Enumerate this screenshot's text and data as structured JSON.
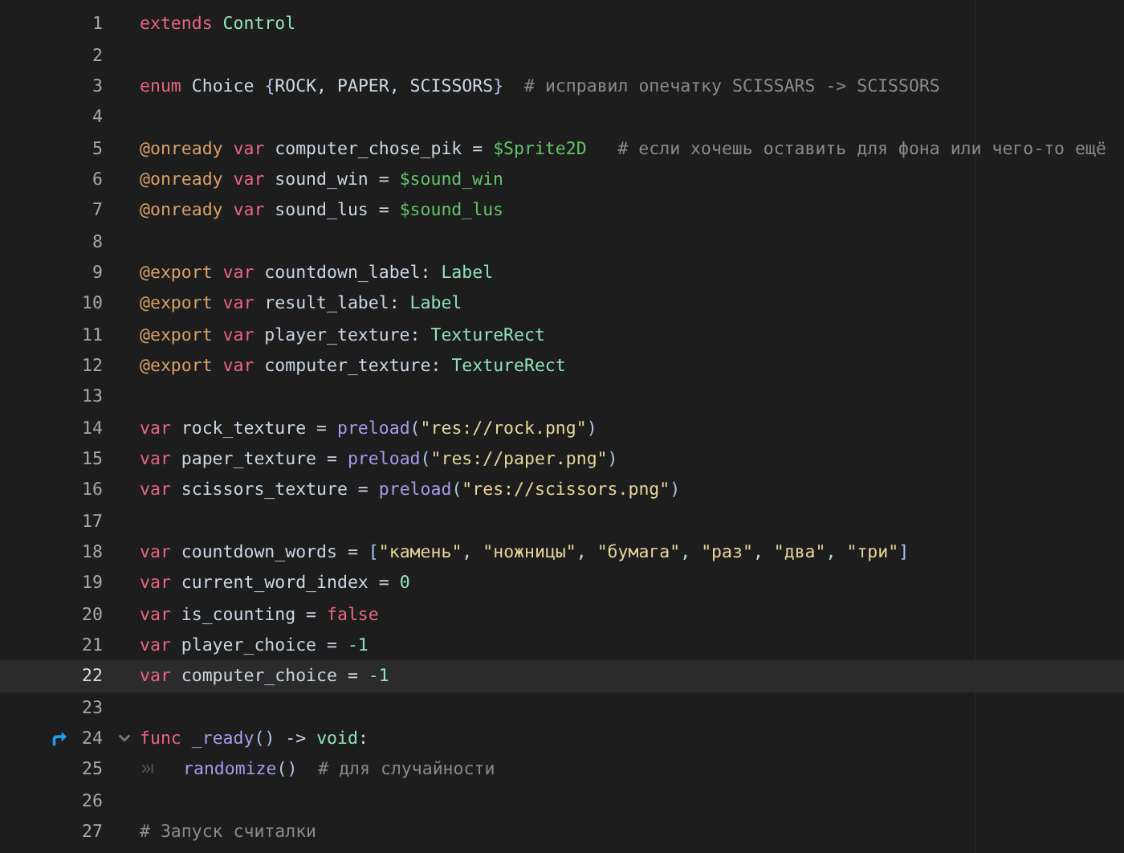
{
  "editor": {
    "lines": [
      {
        "number": "1",
        "current": false,
        "tokens": [
          {
            "kind": "keyword",
            "text": "extends "
          },
          {
            "kind": "type",
            "text": "Control"
          }
        ]
      },
      {
        "number": "2",
        "current": false
      },
      {
        "number": "3",
        "current": false,
        "tokens": [
          {
            "kind": "keyword",
            "text": "enum "
          },
          {
            "kind": "plain",
            "text": "Choice "
          },
          {
            "kind": "bracket",
            "text": "{"
          },
          {
            "kind": "plain",
            "text": "ROCK, PAPER, SCISSORS"
          },
          {
            "kind": "bracket",
            "text": "}  "
          },
          {
            "kind": "comment",
            "text": "# исправил опечатку SCISSARS -> SCISSORS"
          }
        ]
      },
      {
        "number": "4",
        "current": false
      },
      {
        "number": "5",
        "current": false,
        "tokens": [
          {
            "kind": "annotation",
            "text": "@onready "
          },
          {
            "kind": "keyword",
            "text": "var"
          },
          {
            "kind": "plain",
            "text": " computer_chose_pik = "
          },
          {
            "kind": "nodepath",
            "text": "$Sprite2D   "
          },
          {
            "kind": "comment",
            "text": "# если хочешь оставить для фона или чего-то ещё"
          }
        ]
      },
      {
        "number": "6",
        "current": false,
        "tokens": [
          {
            "kind": "annotation",
            "text": "@onready "
          },
          {
            "kind": "keyword",
            "text": "var"
          },
          {
            "kind": "plain",
            "text": " sound_win = "
          },
          {
            "kind": "nodepath",
            "text": "$sound_win"
          }
        ]
      },
      {
        "number": "7",
        "current": false,
        "tokens": [
          {
            "kind": "annotation",
            "text": "@onready "
          },
          {
            "kind": "keyword",
            "text": "var"
          },
          {
            "kind": "plain",
            "text": " sound_lus = "
          },
          {
            "kind": "nodepath",
            "text": "$sound_lus"
          }
        ]
      },
      {
        "number": "8",
        "current": false
      },
      {
        "number": "9",
        "current": false,
        "tokens": [
          {
            "kind": "annotation",
            "text": "@export "
          },
          {
            "kind": "keyword",
            "text": "var"
          },
          {
            "kind": "plain",
            "text": " countdown_label: "
          },
          {
            "kind": "type",
            "text": "Label"
          }
        ]
      },
      {
        "number": "10",
        "current": false,
        "tokens": [
          {
            "kind": "annotation",
            "text": "@export "
          },
          {
            "kind": "keyword",
            "text": "var"
          },
          {
            "kind": "plain",
            "text": " result_label: "
          },
          {
            "kind": "type",
            "text": "Label"
          }
        ]
      },
      {
        "number": "11",
        "current": false,
        "tokens": [
          {
            "kind": "annotation",
            "text": "@export "
          },
          {
            "kind": "keyword",
            "text": "var"
          },
          {
            "kind": "plain",
            "text": " player_texture: "
          },
          {
            "kind": "type",
            "text": "TextureRect"
          }
        ]
      },
      {
        "number": "12",
        "current": false,
        "tokens": [
          {
            "kind": "annotation",
            "text": "@export "
          },
          {
            "kind": "keyword",
            "text": "var"
          },
          {
            "kind": "plain",
            "text": " computer_texture: "
          },
          {
            "kind": "type",
            "text": "TextureRect"
          }
        ]
      },
      {
        "number": "13",
        "current": false
      },
      {
        "number": "14",
        "current": false,
        "tokens": [
          {
            "kind": "keyword",
            "text": "var"
          },
          {
            "kind": "plain",
            "text": " rock_texture = "
          },
          {
            "kind": "function",
            "text": "preload"
          },
          {
            "kind": "bracket",
            "text": "("
          },
          {
            "kind": "string",
            "text": "\"res://rock.png\""
          },
          {
            "kind": "bracket",
            "text": ")"
          }
        ]
      },
      {
        "number": "15",
        "current": false,
        "tokens": [
          {
            "kind": "keyword",
            "text": "var"
          },
          {
            "kind": "plain",
            "text": " paper_texture = "
          },
          {
            "kind": "function",
            "text": "preload"
          },
          {
            "kind": "bracket",
            "text": "("
          },
          {
            "kind": "string",
            "text": "\"res://paper.png\""
          },
          {
            "kind": "bracket",
            "text": ")"
          }
        ]
      },
      {
        "number": "16",
        "current": false,
        "tokens": [
          {
            "kind": "keyword",
            "text": "var"
          },
          {
            "kind": "plain",
            "text": " scissors_texture = "
          },
          {
            "kind": "function",
            "text": "preload"
          },
          {
            "kind": "bracket",
            "text": "("
          },
          {
            "kind": "string",
            "text": "\"res://scissors.png\""
          },
          {
            "kind": "bracket",
            "text": ")"
          }
        ]
      },
      {
        "number": "17",
        "current": false
      },
      {
        "number": "18",
        "current": false,
        "tokens": [
          {
            "kind": "keyword",
            "text": "var"
          },
          {
            "kind": "plain",
            "text": " countdown_words = "
          },
          {
            "kind": "bracket",
            "text": "["
          },
          {
            "kind": "string",
            "text": "\"камень\""
          },
          {
            "kind": "plain",
            "text": ", "
          },
          {
            "kind": "string",
            "text": "\"ножницы\""
          },
          {
            "kind": "plain",
            "text": ", "
          },
          {
            "kind": "string",
            "text": "\"бумага\""
          },
          {
            "kind": "plain",
            "text": ", "
          },
          {
            "kind": "string",
            "text": "\"раз\""
          },
          {
            "kind": "plain",
            "text": ", "
          },
          {
            "kind": "string",
            "text": "\"два\""
          },
          {
            "kind": "plain",
            "text": ", "
          },
          {
            "kind": "string",
            "text": "\"три\""
          },
          {
            "kind": "bracket",
            "text": "]"
          }
        ]
      },
      {
        "number": "19",
        "current": false,
        "tokens": [
          {
            "kind": "keyword",
            "text": "var"
          },
          {
            "kind": "plain",
            "text": " current_word_index = "
          },
          {
            "kind": "number",
            "text": "0"
          }
        ]
      },
      {
        "number": "20",
        "current": false,
        "tokens": [
          {
            "kind": "keyword",
            "text": "var"
          },
          {
            "kind": "plain",
            "text": " is_counting = "
          },
          {
            "kind": "keyword",
            "text": "false"
          }
        ]
      },
      {
        "number": "21",
        "current": false,
        "tokens": [
          {
            "kind": "keyword",
            "text": "var"
          },
          {
            "kind": "plain",
            "text": " player_choice = "
          },
          {
            "kind": "number",
            "text": "-1"
          }
        ]
      },
      {
        "number": "22",
        "current": true,
        "tokens": [
          {
            "kind": "keyword",
            "text": "var"
          },
          {
            "kind": "plain",
            "text": " computer_choice = "
          },
          {
            "kind": "number",
            "text": "-1"
          }
        ]
      },
      {
        "number": "23",
        "current": false
      },
      {
        "number": "24",
        "current": false,
        "override_marker": true,
        "fold": {
          "expanded": true
        },
        "tokens": [
          {
            "kind": "keyword",
            "text": "func "
          },
          {
            "kind": "function",
            "text": "_ready"
          },
          {
            "kind": "bracket",
            "text": "()"
          },
          {
            "kind": "plain",
            "text": " -> "
          },
          {
            "kind": "type",
            "text": "void"
          },
          {
            "kind": "plain",
            "text": ":"
          }
        ]
      },
      {
        "number": "25",
        "current": false,
        "indent": true,
        "tokens": [
          {
            "kind": "function",
            "text": "randomize"
          },
          {
            "kind": "bracket",
            "text": "()  "
          },
          {
            "kind": "comment",
            "text": "# для случайности"
          }
        ]
      },
      {
        "number": "26",
        "current": false
      },
      {
        "number": "27",
        "current": false,
        "tokens": [
          {
            "kind": "comment",
            "text": "# Запуск считалки"
          }
        ]
      }
    ]
  }
}
